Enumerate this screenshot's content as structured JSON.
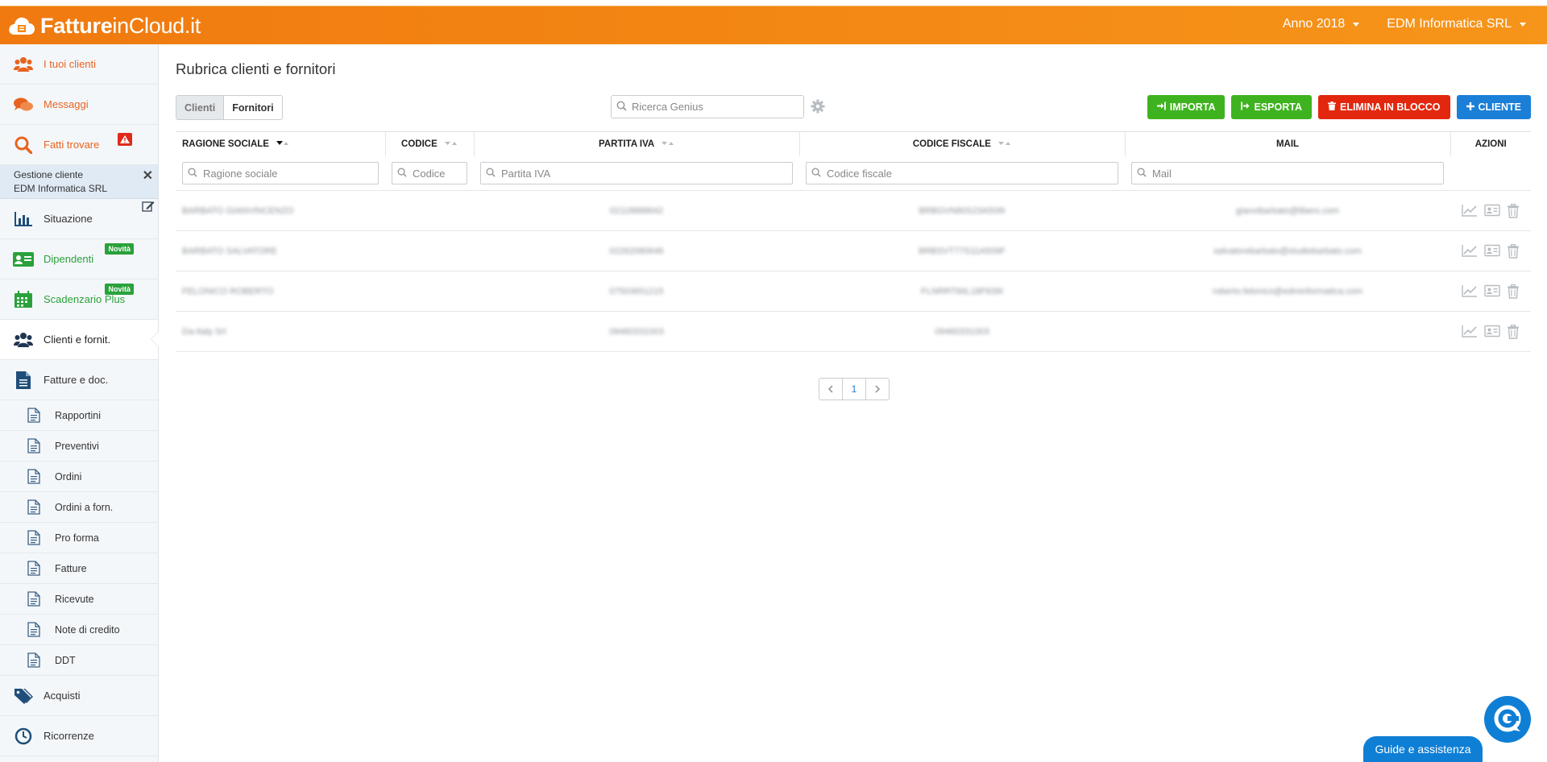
{
  "app": {
    "logo_bold": "Fatture",
    "logo_thin": "inCloud.it",
    "year_label": "Anno 2018",
    "company_label": "EDM Informatica SRL"
  },
  "sidebar": {
    "top_items": [
      {
        "label": "I tuoi clienti",
        "icon": "people-icon"
      },
      {
        "label": "Messaggi",
        "icon": "chat-bubbles-icon"
      },
      {
        "label": "Fatti trovare",
        "icon": "search-icon"
      }
    ],
    "client_box": {
      "title": "Gestione cliente",
      "name": "EDM Informatica SRL"
    },
    "items": [
      {
        "label": "Situazione",
        "icon": "bar-chart-icon"
      },
      {
        "label": "Dipendenti",
        "icon": "id-card-icon",
        "badge": "Novità"
      },
      {
        "label": "Scadenzario Plus",
        "icon": "calendar-icon",
        "badge": "Novità"
      },
      {
        "label": "Clienti e fornit.",
        "icon": "people-icon"
      },
      {
        "label": "Fatture e doc.",
        "icon": "document-icon"
      }
    ],
    "sub_items": [
      "Rapportini",
      "Preventivi",
      "Ordini",
      "Ordini a forn.",
      "Pro forma",
      "Fatture",
      "Ricevute",
      "Note di credito",
      "DDT"
    ],
    "bottom_items": [
      {
        "label": "Acquisti",
        "icon": "tags-icon"
      },
      {
        "label": "Ricorrenze",
        "icon": "clock-icon"
      }
    ]
  },
  "main": {
    "title": "Rubrica clienti e fornitori",
    "tabs": [
      "Clienti",
      "Fornitori"
    ],
    "search_placeholder": "Ricerca Genius",
    "buttons": {
      "import": "IMPORTA",
      "export": "ESPORTA",
      "delete_bulk": "ELIMINA IN BLOCCO",
      "add_client": "CLIENTE"
    },
    "columns": [
      "RAGIONE SOCIALE",
      "CODICE",
      "PARTITA IVA",
      "CODICE FISCALE",
      "MAIL",
      "AZIONI"
    ],
    "filters": {
      "ragione_sociale": "Ragione sociale",
      "codice": "Codice",
      "partita_iva": "Partita IVA",
      "codice_fiscale": "Codice fiscale",
      "mail": "Mail"
    },
    "rows": [
      {
        "name": "BARBATO GIANVINCENZO",
        "code": "",
        "piva": "02118888642",
        "cf": "BRBGVN80S23A509I",
        "mail": "gianvibarbato@libero.com"
      },
      {
        "name": "BARBATO SALVATORE",
        "code": "",
        "piva": "02262080646",
        "cf": "BRBSVT77S11A509F",
        "mail": "salvatorebarbato@studiobarbato.com"
      },
      {
        "name": "FELONICO ROBERTO",
        "code": "",
        "piva": "07503651215",
        "cf": "FLNRRT66L18F839I",
        "mail": "roberto.felonico@edminformatica.com"
      },
      {
        "name": "Da-Italy Srl",
        "code": "",
        "piva": "09460331003",
        "cf": "09460331003",
        "mail": ""
      }
    ],
    "pager": {
      "page": "1"
    }
  },
  "help": {
    "guide_label": "Guide e assistenza"
  },
  "colors": {
    "brand_orange": "#f48a14",
    "green": "#3fb31f",
    "red": "#e3270e",
    "blue": "#1b7fd8"
  }
}
